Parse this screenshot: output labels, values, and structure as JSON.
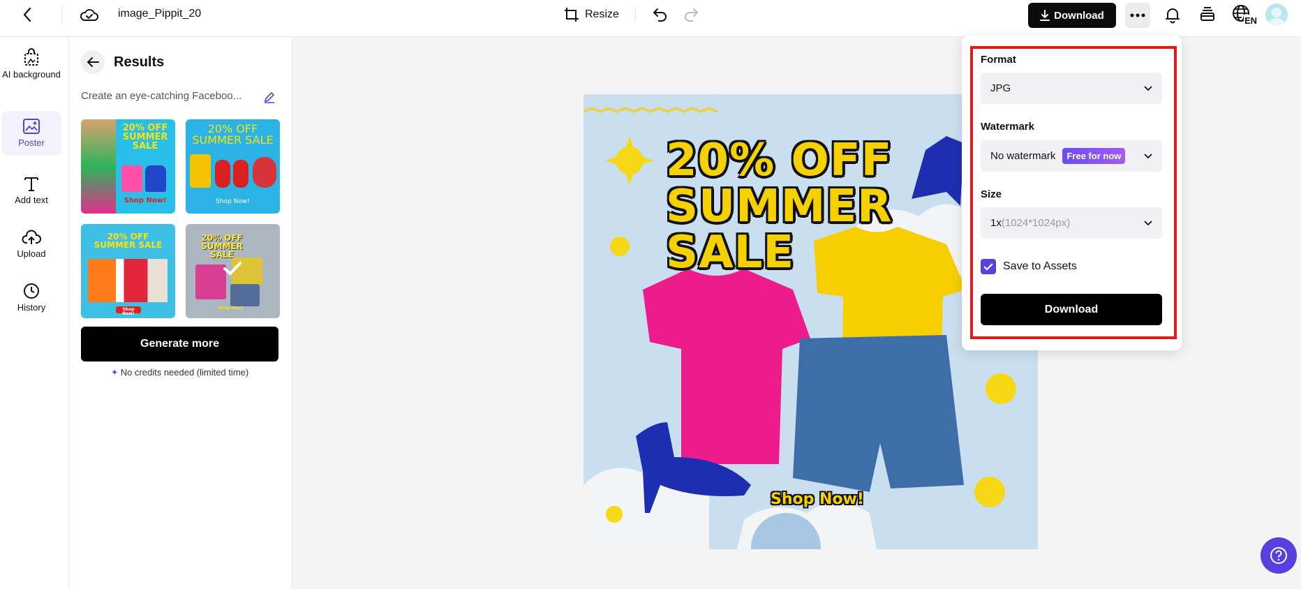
{
  "topbar": {
    "title": "image_Pippit_20",
    "resize_label": "Resize",
    "download_label": "Download",
    "lang_code": "EN"
  },
  "leftnav": {
    "items": [
      {
        "label": "AI background",
        "icon": "bag-icon"
      },
      {
        "label": "Poster",
        "icon": "poster-icon",
        "active": true
      },
      {
        "label": "Add text",
        "icon": "text-icon"
      },
      {
        "label": "Upload",
        "icon": "upload-cloud-icon"
      },
      {
        "label": "History",
        "icon": "clock-icon"
      }
    ]
  },
  "results": {
    "title": "Results",
    "prompt": "Create an eye-catching Faceboo...",
    "thumbnails": [
      {
        "headline": "20% OFF SUMMER SALE",
        "cta": "Shop Now!"
      },
      {
        "headline": "20% OFF SUMMER SALE",
        "cta": "Shop Now!"
      },
      {
        "headline": "20% OFF SUMMER SALE",
        "cta": "Shop Now!"
      },
      {
        "headline": "20% OFF SUMMER SALE",
        "cta": "Shop Now!",
        "selected": true
      }
    ],
    "generate_label": "Generate more",
    "credits_note": "No credits needed (limited time)"
  },
  "canvas": {
    "headline_1": "20% OFF",
    "headline_2": "SUMMER",
    "headline_3": "SALE",
    "cta": "Shop Now!"
  },
  "download_panel": {
    "format_label": "Format",
    "format_value": "JPG",
    "watermark_label": "Watermark",
    "watermark_value": "No watermark",
    "watermark_badge": "Free for now",
    "size_label": "Size",
    "size_scale": "1x",
    "size_dims": "(1024*1024px)",
    "save_assets_label": "Save to Assets",
    "save_assets_checked": true,
    "download_label": "Download"
  },
  "colors": {
    "accent": "#5a3fe0",
    "highlight_outline": "#e01b1b",
    "poster_yellow": "#f6d100"
  }
}
